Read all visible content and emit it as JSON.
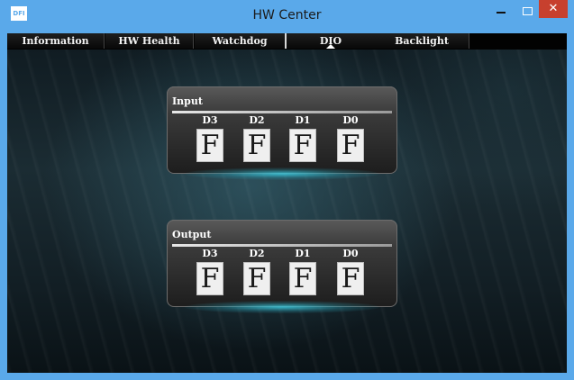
{
  "window": {
    "title": "HW Center",
    "icon_text": "DFI",
    "icon_name": "app-logo-icon",
    "minimize_glyph": "–",
    "close_glyph": "✕"
  },
  "tabs": [
    {
      "label": "Information",
      "active": false
    },
    {
      "label": "HW Health",
      "active": false
    },
    {
      "label": "Watchdog",
      "active": false
    },
    {
      "label": "DIO",
      "active": true
    },
    {
      "label": "Backlight",
      "active": false
    }
  ],
  "input": {
    "title": "Input",
    "bits": [
      {
        "label": "D3",
        "value": "F"
      },
      {
        "label": "D2",
        "value": "F"
      },
      {
        "label": "D1",
        "value": "F"
      },
      {
        "label": "D0",
        "value": "F"
      }
    ]
  },
  "output": {
    "title": "Output",
    "bits": [
      {
        "label": "D3",
        "value": "F"
      },
      {
        "label": "D2",
        "value": "F"
      },
      {
        "label": "D1",
        "value": "F"
      },
      {
        "label": "D0",
        "value": "F"
      }
    ]
  },
  "colors": {
    "titlebar": "#5aa9ea",
    "close_button": "#c7402e",
    "tab_bar": "#020202",
    "panel_glow": "#3cc8dc"
  }
}
